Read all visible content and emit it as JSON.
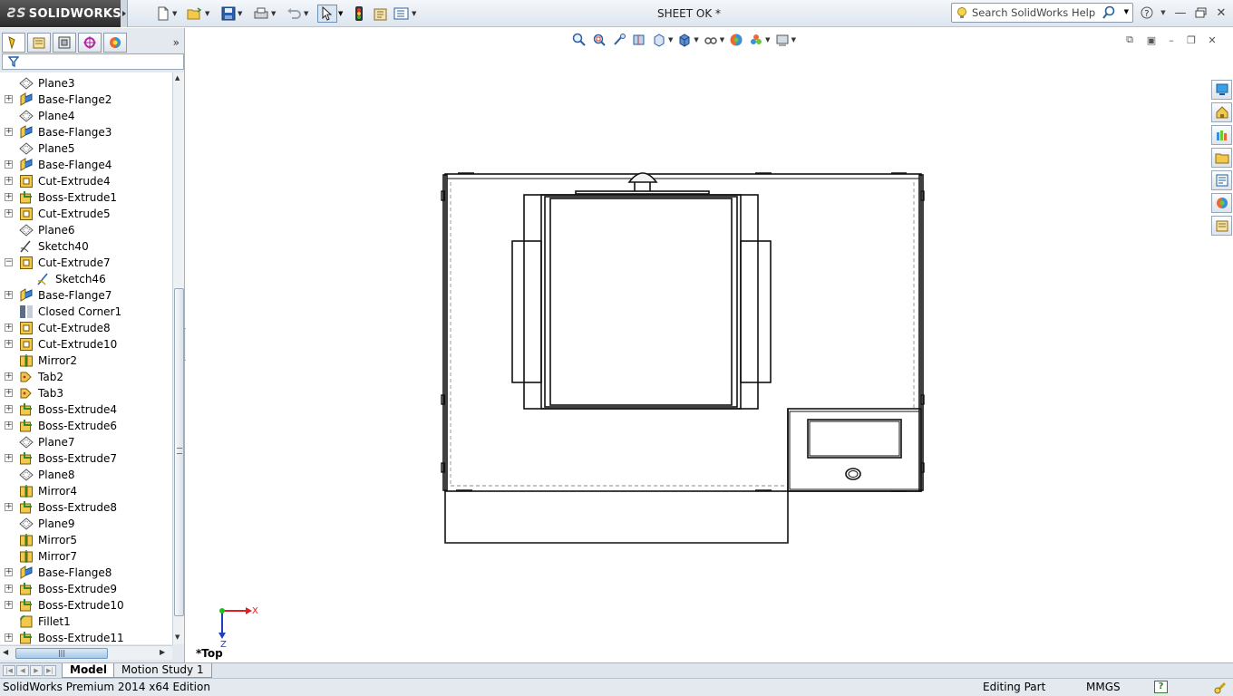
{
  "app": {
    "brand": "SOLIDWORKS",
    "brand_prefix": "3S"
  },
  "window": {
    "document_title": "SHEET OK *"
  },
  "toolbar": {
    "items": [
      "new-file-icon",
      "open-file-icon",
      "save-icon",
      "print-icon",
      "undo-icon",
      "select-icon",
      "rebuild-icon",
      "file-properties-icon",
      "options-icon"
    ]
  },
  "search": {
    "placeholder": "Search SolidWorks Help"
  },
  "feature_tree": {
    "items": [
      {
        "label": "Plane3",
        "type": "plane",
        "expandable": false,
        "indent": 0
      },
      {
        "label": "Base-Flange2",
        "type": "flange",
        "expandable": true,
        "indent": 0
      },
      {
        "label": "Plane4",
        "type": "plane",
        "expandable": false,
        "indent": 0
      },
      {
        "label": "Base-Flange3",
        "type": "flange",
        "expandable": true,
        "indent": 0
      },
      {
        "label": "Plane5",
        "type": "plane",
        "expandable": false,
        "indent": 0
      },
      {
        "label": "Base-Flange4",
        "type": "flange",
        "expandable": true,
        "indent": 0
      },
      {
        "label": "Cut-Extrude4",
        "type": "cut",
        "expandable": true,
        "indent": 0
      },
      {
        "label": "Boss-Extrude1",
        "type": "boss",
        "expandable": true,
        "indent": 0
      },
      {
        "label": "Cut-Extrude5",
        "type": "cut",
        "expandable": true,
        "indent": 0
      },
      {
        "label": "Plane6",
        "type": "plane",
        "expandable": false,
        "indent": 0
      },
      {
        "label": "Sketch40",
        "type": "sketch",
        "expandable": false,
        "indent": 0
      },
      {
        "label": "Cut-Extrude7",
        "type": "cut",
        "expandable": true,
        "expanded": true,
        "indent": 0
      },
      {
        "label": "Sketch46",
        "type": "sketch-sub",
        "expandable": false,
        "indent": 1
      },
      {
        "label": "Base-Flange7",
        "type": "flange",
        "expandable": true,
        "indent": 0
      },
      {
        "label": "Closed Corner1",
        "type": "corner",
        "expandable": false,
        "indent": 0
      },
      {
        "label": "Cut-Extrude8",
        "type": "cut",
        "expandable": true,
        "indent": 0
      },
      {
        "label": "Cut-Extrude10",
        "type": "cut",
        "expandable": true,
        "indent": 0
      },
      {
        "label": "Mirror2",
        "type": "mirror",
        "expandable": false,
        "indent": 0
      },
      {
        "label": "Tab2",
        "type": "tab",
        "expandable": true,
        "indent": 0
      },
      {
        "label": "Tab3",
        "type": "tab",
        "expandable": true,
        "indent": 0
      },
      {
        "label": "Boss-Extrude4",
        "type": "boss",
        "expandable": true,
        "indent": 0
      },
      {
        "label": "Boss-Extrude6",
        "type": "boss",
        "expandable": true,
        "indent": 0
      },
      {
        "label": "Plane7",
        "type": "plane",
        "expandable": false,
        "indent": 0
      },
      {
        "label": "Boss-Extrude7",
        "type": "boss",
        "expandable": true,
        "indent": 0
      },
      {
        "label": "Plane8",
        "type": "plane",
        "expandable": false,
        "indent": 0
      },
      {
        "label": "Mirror4",
        "type": "mirror",
        "expandable": false,
        "indent": 0
      },
      {
        "label": "Boss-Extrude8",
        "type": "boss",
        "expandable": true,
        "indent": 0
      },
      {
        "label": "Plane9",
        "type": "plane",
        "expandable": false,
        "indent": 0
      },
      {
        "label": "Mirror5",
        "type": "mirror",
        "expandable": false,
        "indent": 0
      },
      {
        "label": "Mirror7",
        "type": "mirror",
        "expandable": false,
        "indent": 0
      },
      {
        "label": "Base-Flange8",
        "type": "flange",
        "expandable": true,
        "indent": 0
      },
      {
        "label": "Boss-Extrude9",
        "type": "boss",
        "expandable": true,
        "indent": 0
      },
      {
        "label": "Boss-Extrude10",
        "type": "boss",
        "expandable": true,
        "indent": 0
      },
      {
        "label": "Fillet1",
        "type": "fillet",
        "expandable": false,
        "indent": 0
      },
      {
        "label": "Boss-Extrude11",
        "type": "boss",
        "expandable": true,
        "indent": 0
      }
    ]
  },
  "viewport": {
    "view_label": "*Top",
    "axis_x": "X",
    "axis_z": "Z"
  },
  "bottom_tabs": [
    "Model",
    "Motion Study 1"
  ],
  "status": {
    "edition": "SolidWorks Premium 2014 x64 Edition",
    "mode": "Editing Part",
    "units": "MMGS"
  },
  "colors": {
    "accent": "#1f5fae",
    "status_bg": "#e4e9ef",
    "panel_bg": "#e4e9ef"
  }
}
